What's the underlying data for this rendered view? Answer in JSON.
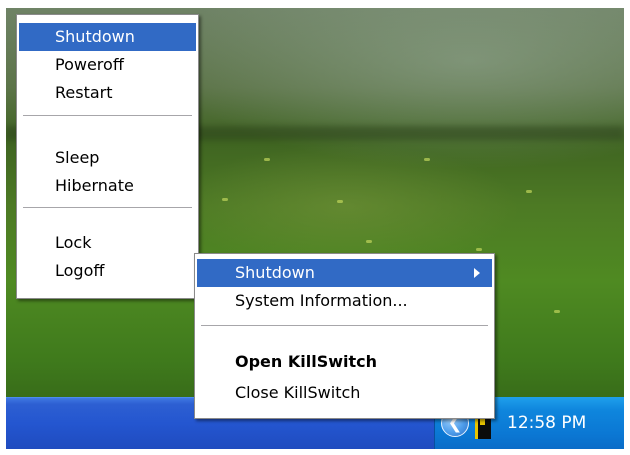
{
  "left_menu": {
    "items": [
      {
        "label": "Shutdown"
      },
      {
        "label": "Poweroff"
      },
      {
        "label": "Restart"
      },
      {
        "label": "Sleep"
      },
      {
        "label": "Hibernate"
      },
      {
        "label": "Lock"
      },
      {
        "label": "Logoff"
      }
    ],
    "selected": "Shutdown"
  },
  "tray_menu": {
    "items": [
      {
        "label": "Shutdown"
      },
      {
        "label": "System Information..."
      },
      {
        "label": "Open KillSwitch"
      },
      {
        "label": "Close KillSwitch"
      }
    ],
    "selected": "Shutdown",
    "default": "Open KillSwitch"
  },
  "taskbar": {
    "clock": "12:58 PM",
    "chevron_glyph": "❮"
  },
  "icons": {
    "show_hidden_icons": "chevron-left-icon",
    "killswitch": "killswitch-tray-icon"
  },
  "colors": {
    "menu_highlight": "#316ac5",
    "taskbar": "#2456d0",
    "tray": "#0b78d4"
  }
}
